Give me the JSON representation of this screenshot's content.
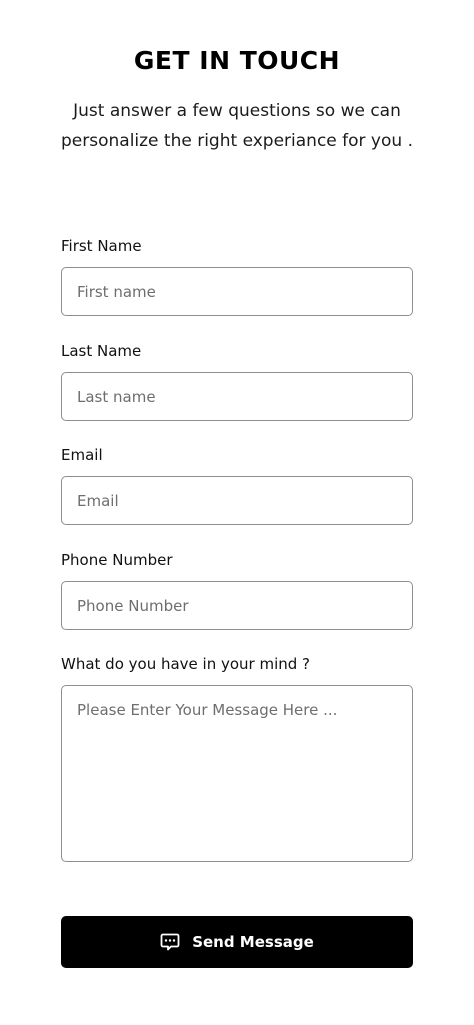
{
  "header": {
    "title": "GET IN TOUCH",
    "subtitle": "Just answer a few questions so we can personalize the right experiance for you ."
  },
  "form": {
    "first_name": {
      "label": "First Name",
      "placeholder": "First name"
    },
    "last_name": {
      "label": "Last Name",
      "placeholder": "Last name"
    },
    "email": {
      "label": "Email",
      "placeholder": "Email"
    },
    "phone": {
      "label": "Phone Number",
      "placeholder": "Phone Number"
    },
    "message": {
      "label": "What do you have in your mind ?",
      "placeholder": "Please Enter Your Message Here ..."
    }
  },
  "actions": {
    "send_label": "Send Message",
    "send_icon": "chat-message-icon"
  }
}
